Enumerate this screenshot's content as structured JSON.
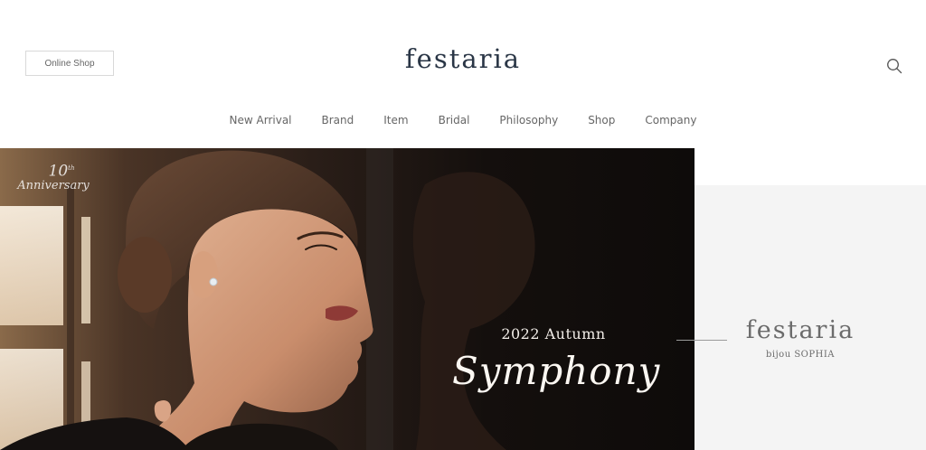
{
  "header": {
    "online_shop_label": "Online Shop",
    "logo": "festaria",
    "search_icon": "search-icon"
  },
  "nav": {
    "items": [
      {
        "label": "New Arrival"
      },
      {
        "label": "Brand"
      },
      {
        "label": "Item"
      },
      {
        "label": "Bridal"
      },
      {
        "label": "Philosophy"
      },
      {
        "label": "Shop"
      },
      {
        "label": "Company"
      }
    ]
  },
  "hero": {
    "anniversary_number": "10",
    "anniversary_suffix": "th",
    "anniversary_word": "Anniversary",
    "season": "2022 Autumn",
    "collection": "Symphony"
  },
  "side": {
    "brand": "festaria",
    "sub_brand": "bijou SOPHIA"
  },
  "colors": {
    "logo": "#2a3646",
    "nav_text": "#666666",
    "panel_bg": "#f4f4f4",
    "hero_dark": "#1a1412"
  }
}
